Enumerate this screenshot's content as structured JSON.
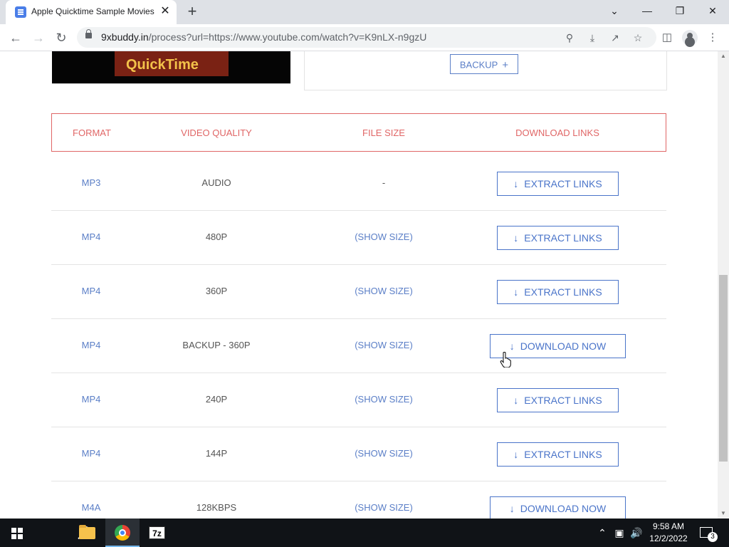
{
  "browser": {
    "tab_title": "Apple Quicktime Sample Movies",
    "tab_close": "✕",
    "new_tab": "+",
    "url_host": "9xbuddy.in",
    "url_rest": "/process?url=https://www.youtube.com/watch?v=K9nLX-n9gzU",
    "window_controls": {
      "menu": "⌄",
      "minimize": "—",
      "restore": "❐",
      "close": "✕"
    }
  },
  "page": {
    "thumbnail_text": "QuickTime",
    "backup_button": {
      "label": "BACKUP",
      "icon": "+"
    },
    "table": {
      "headers": [
        "FORMAT",
        "VIDEO QUALITY",
        "FILE SIZE",
        "DOWNLOAD LINKS"
      ],
      "rows": [
        {
          "format": "MP3",
          "quality": "AUDIO",
          "size": "-",
          "action": "EXTRACT LINKS"
        },
        {
          "format": "MP4",
          "quality": "480P",
          "size": "(SHOW SIZE)",
          "action": "EXTRACT LINKS"
        },
        {
          "format": "MP4",
          "quality": "360P",
          "size": "(SHOW SIZE)",
          "action": "EXTRACT LINKS"
        },
        {
          "format": "MP4",
          "quality": "BACKUP - 360P",
          "size": "(SHOW SIZE)",
          "action": "DOWNLOAD NOW"
        },
        {
          "format": "MP4",
          "quality": "240P",
          "size": "(SHOW SIZE)",
          "action": "EXTRACT LINKS"
        },
        {
          "format": "MP4",
          "quality": "144P",
          "size": "(SHOW SIZE)",
          "action": "EXTRACT LINKS"
        },
        {
          "format": "M4A",
          "quality": "128KBPS",
          "size": "(SHOW SIZE)",
          "action": "DOWNLOAD NOW"
        }
      ]
    }
  },
  "taskbar": {
    "sevenzip_label": "7z",
    "time": "9:58 AM",
    "date": "12/2/2022",
    "notification_count": "3"
  },
  "colors": {
    "accent_blue": "#4a74c9",
    "header_red": "#e06666"
  }
}
